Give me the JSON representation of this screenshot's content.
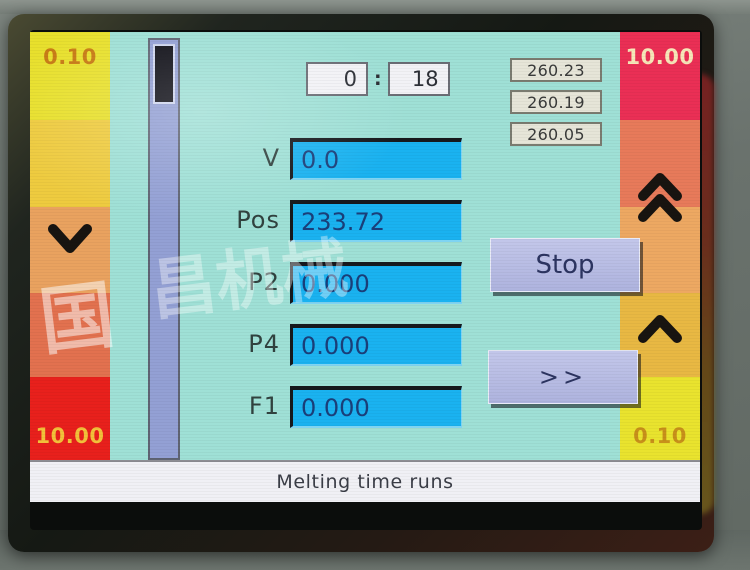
{
  "device": {
    "kind": "hmi-touch-panel"
  },
  "screen": {
    "background_color": "#9fe0d6",
    "left_ramp": {
      "name": "jog-speed-down-ramp",
      "top_value": "0.10",
      "bottom_value": "10.00",
      "top_value_color": "#c87a12",
      "bottom_value_color": "#f2c13a",
      "icon": "chevron-down-icon",
      "segment_colors": [
        "#e8e02c",
        "#eecb3f",
        "#e9a25f",
        "#e2714f",
        "#e8201c"
      ]
    },
    "right_ramp": {
      "name": "jog-speed-up-ramp",
      "top_value": "10.00",
      "bottom_value": "0.10",
      "top_value_color": "#f6e6b8",
      "bottom_value_color": "#c8901a",
      "icon_fast": "chevron-double-up-icon",
      "icon_slow": "chevron-up-icon",
      "segment_colors": [
        "#ea2f55",
        "#e77a5a",
        "#eda862",
        "#e8b843",
        "#e9e32e"
      ]
    },
    "slider": {
      "name": "position-slider",
      "track_color": "#93a0d4",
      "thumb_color": "#101018",
      "thumb_position_percent": 2
    },
    "timer": {
      "minutes": "0",
      "separator": ":",
      "seconds": "18"
    },
    "readouts": [
      {
        "label": "readout-1",
        "value": "260.23"
      },
      {
        "label": "readout-2",
        "value": "260.19"
      },
      {
        "label": "readout-3",
        "value": "260.05"
      }
    ],
    "fields": [
      {
        "label": "V",
        "value": "0.0"
      },
      {
        "label": "Pos",
        "value": "233.72"
      },
      {
        "label": "P2",
        "value": "0.000"
      },
      {
        "label": "P4",
        "value": "0.000"
      },
      {
        "label": "F1",
        "value": "0.000"
      }
    ],
    "buttons": {
      "stop": "Stop",
      "next": ">>"
    },
    "status_bar": {
      "message": "Melting time runs",
      "background_color": "#f0f0f5"
    },
    "watermark": {
      "line1": "国",
      "line2": "昌机械"
    }
  }
}
